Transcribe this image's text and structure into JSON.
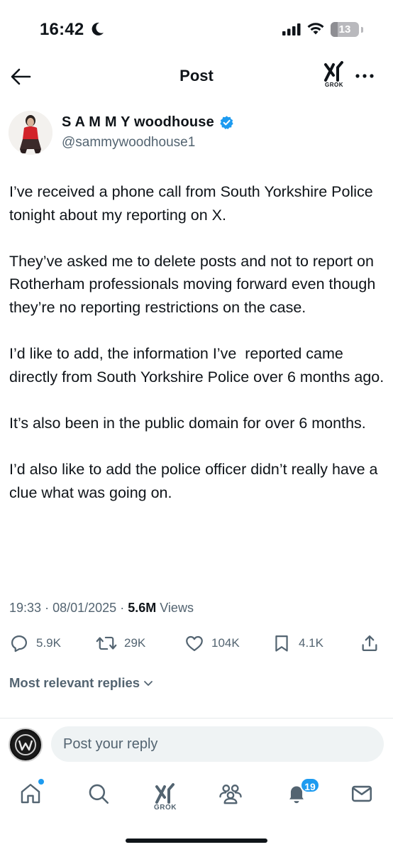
{
  "status_bar": {
    "time": "16:42",
    "battery": "13",
    "icons": [
      "moon-icon",
      "signal-icon",
      "wifi-icon",
      "battery-icon"
    ]
  },
  "nav": {
    "title": "Post",
    "grok_label": "GROK",
    "icons": [
      "back-arrow-icon",
      "grok-icon",
      "more-icon"
    ]
  },
  "post": {
    "display_name": "S A M M Y woodhouse",
    "handle": "@sammywoodhouse1",
    "verified_color": "#1d9bf0",
    "text": "I’ve received a phone call from South Yorkshire Police tonight about my reporting on X.\n\nThey’ve asked me to delete posts and not to report on Rotherham professionals moving forward even though they’re no reporting restrictions on the case.\n\nI’d like to add, the information I’ve  reported came directly from South Yorkshire Police over 6 months ago.\n\nIt’s also been in the public domain for over 6 months.\n\nI’d also like to add the police officer didn’t really have a clue what was going on.",
    "time": "19:33",
    "date": "08/01/2025",
    "views_count": "5.6M",
    "views_label": "Views",
    "separator": "·"
  },
  "actions": {
    "replies": "5.9K",
    "reposts": "29K",
    "likes": "104K",
    "bookmarks": "4.1K"
  },
  "replies_sort": "Most relevant replies",
  "reply_box": {
    "placeholder": "Post your reply"
  },
  "tab_bar": {
    "grok_label": "GROK",
    "notifications_badge": "19",
    "accent": "#1d9bf0"
  }
}
